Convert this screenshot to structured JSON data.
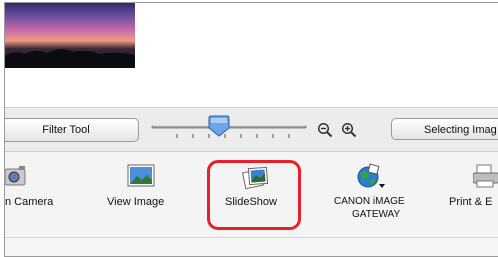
{
  "toolbar": {
    "filter_tool_label": "Filter Tool",
    "selecting_label": "Selecting Imag"
  },
  "tools": [
    {
      "label": "n Camera",
      "icon": "camera-icon"
    },
    {
      "label": "View Image",
      "icon": "view-image-icon"
    },
    {
      "label": "SlideShow",
      "icon": "slideshow-icon"
    },
    {
      "label_line1": "CANON iMAGE",
      "label_line2": "GATEWAY",
      "icon": "canon-image-gateway-icon"
    },
    {
      "label": "Print & E",
      "icon": "printer-icon"
    }
  ],
  "colors": {
    "highlight": "#e8202a"
  }
}
